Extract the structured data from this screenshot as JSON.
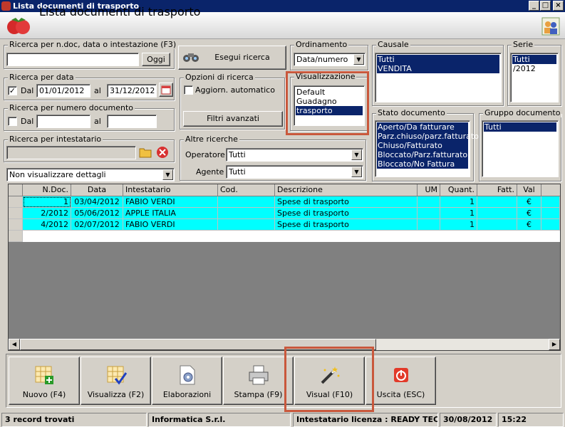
{
  "window": {
    "title": "Lista documenti di trasporto",
    "btn_min": "_",
    "btn_max": "□",
    "btn_close": "×"
  },
  "header": {
    "title": "Lista documenti di trasporto"
  },
  "search": {
    "general_label": "Ricerca per n.doc, data o intestazione (F3)",
    "general_value": "",
    "oggi": "Oggi",
    "esegui": "Esegui ricerca",
    "date_label": "Ricerca per data",
    "dal": "Dal",
    "dal_value": "01/01/2012",
    "al": "al",
    "al_value": "31/12/2012",
    "numero_label": "Ricerca per numero documento",
    "num_dal": "Dal",
    "num_al": "al",
    "intestatario_label": "Ricerca per intestatario",
    "details_value": "Non visualizzare dettagli"
  },
  "opzioni": {
    "label": "Opzioni di ricerca",
    "aggiorn": "Aggiorn. automatico",
    "filtri": "Filtri avanzati"
  },
  "ordinamento": {
    "label": "Ordinamento",
    "value": "Data/numero"
  },
  "visualizzazione": {
    "label": "Visualizzazione",
    "items": [
      "Default",
      "Guadagno",
      "trasporto"
    ]
  },
  "causale": {
    "label": "Causale",
    "items": [
      "Tutti",
      "VENDITA"
    ]
  },
  "serie": {
    "label": "Serie",
    "items": [
      "Tutti",
      "/2012"
    ]
  },
  "stato": {
    "label": "Stato documento",
    "items": [
      "Aperto/Da fatturare",
      "Parz.chiuso/parz.fatturato",
      "Chiuso/Fatturato",
      "Bloccato/Parz.fatturato",
      "Bloccato/No Fattura"
    ]
  },
  "gruppo": {
    "label": "Gruppo documento",
    "items": [
      "Tutti"
    ]
  },
  "altre": {
    "label": "Altre ricerche",
    "operatore": "Operatore :",
    "operatore_value": "Tutti",
    "agente": "Agente :",
    "agente_value": "Tutti"
  },
  "table": {
    "headers": [
      "N.Doc.",
      "Data",
      "Intestatario",
      "Cod.",
      "Descrizione",
      "UM",
      "Quant.",
      "Fatt.",
      "Val"
    ],
    "rows": [
      [
        "1",
        "03/04/2012",
        "FABIO VERDI",
        "",
        "Spese di trasporto",
        "",
        "1",
        "",
        "€"
      ],
      [
        "2/2012",
        "05/06/2012",
        "APPLE ITALIA",
        "",
        "Spese di trasporto",
        "",
        "1",
        "",
        "€"
      ],
      [
        "4/2012",
        "02/07/2012",
        "FABIO VERDI",
        "",
        "Spese di trasporto",
        "",
        "1",
        "",
        "€"
      ]
    ]
  },
  "toolbar": {
    "nuovo": "Nuovo (F4)",
    "visualizza": "Visualizza (F2)",
    "elaborazioni": "Elaborazioni",
    "stampa": "Stampa (F9)",
    "visual": "Visual (F10)",
    "uscita": "Uscita (ESC)"
  },
  "status": {
    "records": "3 record trovati",
    "company": "Informatica S.r.l.",
    "license": "Intestatario licenza : READY TECN",
    "date": "30/08/2012",
    "time": "15:22"
  },
  "colors": {
    "title_bar": "#0a246a",
    "selection": "#0a246a",
    "row_highlight": "#00ffff",
    "annotation": "#c9583c"
  }
}
